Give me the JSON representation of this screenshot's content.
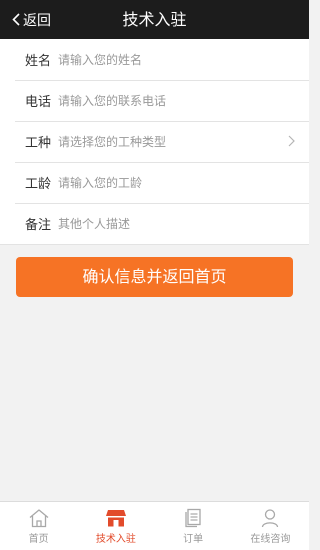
{
  "header": {
    "back_label": "返回",
    "title": "技术入驻"
  },
  "form": {
    "name": {
      "label": "姓名",
      "placeholder": "请输入您的姓名"
    },
    "phone": {
      "label": "电话",
      "placeholder": "请输入您的联系电话"
    },
    "trade": {
      "label": "工种",
      "placeholder": "请选择您的工种类型"
    },
    "years": {
      "label": "工龄",
      "placeholder": "请输入您的工龄"
    },
    "notes": {
      "label": "备注",
      "placeholder": "其他个人描述"
    }
  },
  "confirm_label": "确认信息并返回首页",
  "tabbar": {
    "items": [
      {
        "label": "首页",
        "icon": "home-icon"
      },
      {
        "label": "技术入驻",
        "icon": "shop-icon",
        "active": true
      },
      {
        "label": "订单",
        "icon": "order-icon"
      },
      {
        "label": "在线咨询",
        "icon": "person-icon"
      }
    ]
  },
  "colors": {
    "header_bg": "#1c1c1c",
    "accent": "#f67325",
    "tab_active": "#e24b2b",
    "background": "#f2f2f2"
  }
}
